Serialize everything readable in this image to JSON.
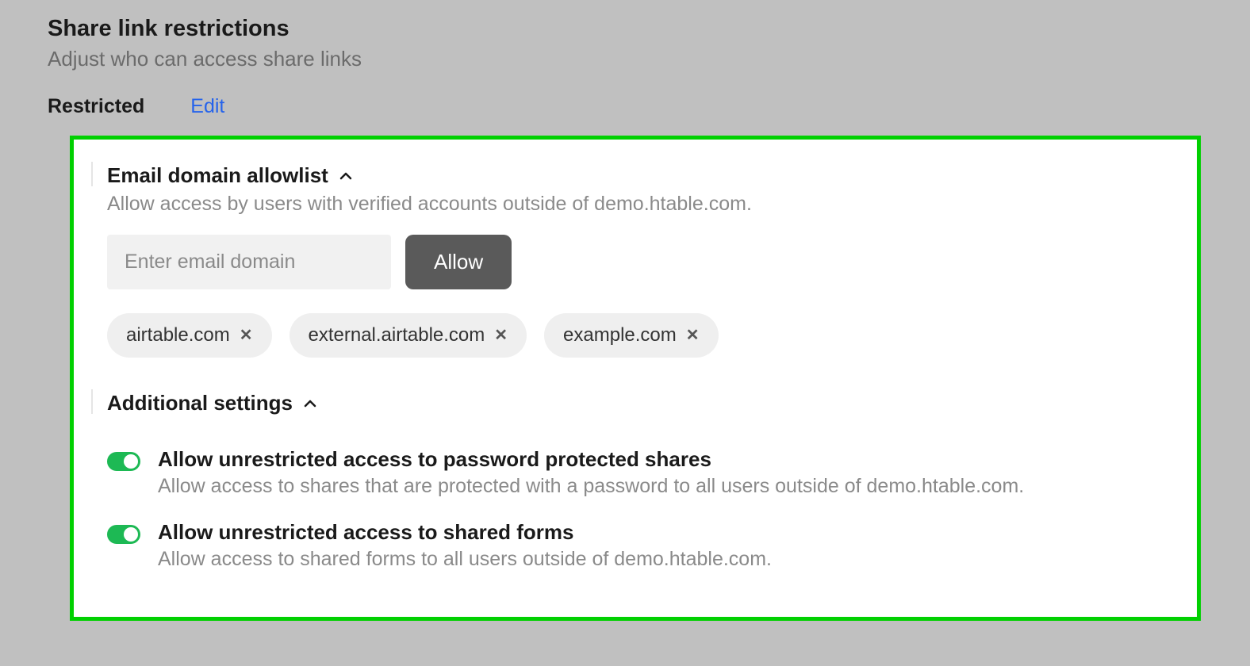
{
  "header": {
    "title": "Share link restrictions",
    "subtitle": "Adjust who can access share links",
    "status": "Restricted",
    "edit_label": "Edit"
  },
  "allowlist": {
    "title": "Email domain allowlist",
    "description": "Allow access by users with verified accounts outside of demo.htable.com.",
    "input_placeholder": "Enter email domain",
    "allow_button": "Allow",
    "domains": [
      {
        "name": "airtable.com"
      },
      {
        "name": "external.airtable.com"
      },
      {
        "name": "example.com"
      }
    ]
  },
  "additional": {
    "title": "Additional settings",
    "settings": [
      {
        "title": "Allow unrestricted access to password protected shares",
        "description": "Allow access to shares that are protected with a password to all users outside of demo.htable.com.",
        "enabled": true
      },
      {
        "title": "Allow unrestricted access to shared forms",
        "description": "Allow access to shared forms to all users outside of demo.htable.com.",
        "enabled": true
      }
    ]
  }
}
